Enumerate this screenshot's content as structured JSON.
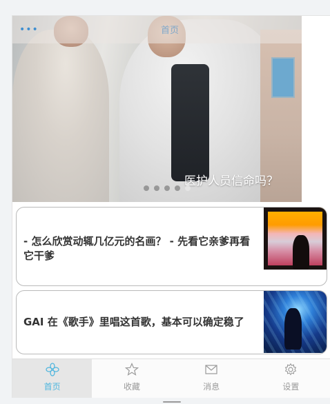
{
  "banner": {
    "menu_icon": "more-dots-icon",
    "top_title": "首页",
    "caption": "医护人员信命吗？",
    "pager": {
      "count": 5,
      "active": 4
    }
  },
  "articles": [
    {
      "title": "- 怎么欣赏动辄几亿元的名画？ - 先看它亲爹再看它干爹",
      "thumb": "painting-thumbnail"
    },
    {
      "title": "GAI 在《歌手》里唱这首歌，基本可以确定稳了",
      "thumb": "concert-thumbnail"
    }
  ],
  "tabbar": {
    "tabs": [
      {
        "label": "首页",
        "icon": "home-flower-icon",
        "active": true
      },
      {
        "label": "收藏",
        "icon": "star-icon",
        "active": false
      },
      {
        "label": "消息",
        "icon": "mail-icon",
        "active": false
      },
      {
        "label": "设置",
        "icon": "gear-icon",
        "active": false
      }
    ]
  },
  "colors": {
    "accent": "#4fb6de",
    "inactive": "#9a9a9a"
  }
}
